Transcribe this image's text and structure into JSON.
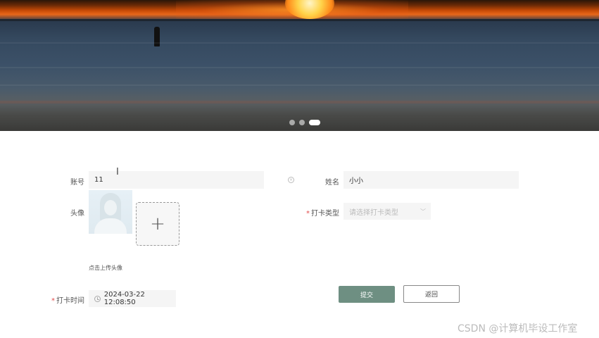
{
  "carousel": {
    "slides": 3,
    "active_index": 2
  },
  "form": {
    "account": {
      "label": "账号",
      "value": "11"
    },
    "name": {
      "label": "姓名",
      "value": "小小"
    },
    "avatar": {
      "label": "头像",
      "hint": "点击上传头像"
    },
    "checkin_type": {
      "label": "打卡类型",
      "placeholder": "请选择打卡类型",
      "required_mark": "*"
    },
    "checkin_time": {
      "label": "打卡时间",
      "value": "2024-03-22 12:08:50",
      "required_mark": "*"
    }
  },
  "buttons": {
    "submit": "提交",
    "back": "返回"
  },
  "watermark": "CSDN @计算机毕设工作室",
  "colors": {
    "submit_bg": "#6e8f82",
    "required": "#e24b4b",
    "input_bg": "#f5f5f5"
  }
}
